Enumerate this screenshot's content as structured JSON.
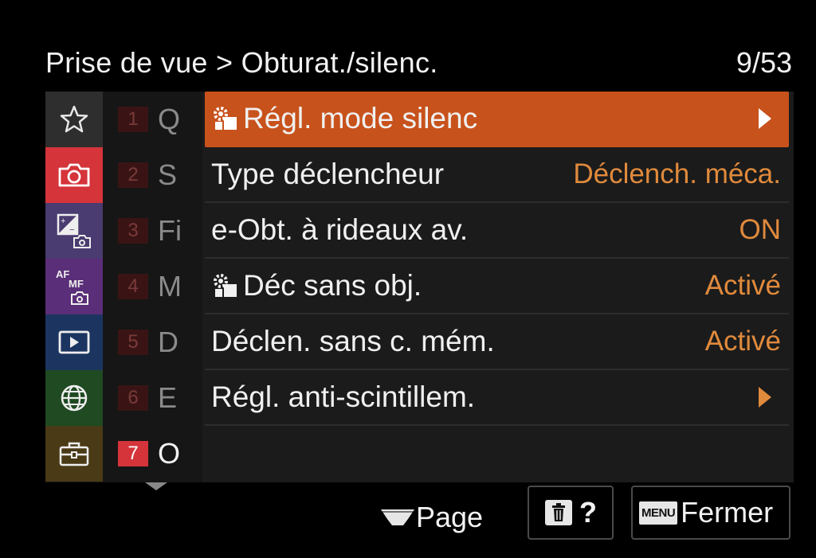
{
  "header": {
    "breadcrumb": "Prise de vue > Obturat./silenc.",
    "page_count": "9/53"
  },
  "categories": [
    {
      "icon": "star-icon",
      "bg": "#2e2e2e",
      "active": false
    },
    {
      "icon": "camera-icon",
      "bg": "#d4343a",
      "active": true
    },
    {
      "icon": "exposure-camera-icon",
      "bg": "#4a3b70",
      "active": false
    },
    {
      "icon": "af-mf-camera-icon",
      "bg": "#5a2e78",
      "active": false
    },
    {
      "icon": "playback-icon",
      "bg": "#1c3560",
      "active": false
    },
    {
      "icon": "network-globe-icon",
      "bg": "#1f4a22",
      "active": false
    },
    {
      "icon": "toolbox-icon",
      "bg": "#4a3a16",
      "active": false
    }
  ],
  "subpages": [
    {
      "num": "1",
      "letter": "Q"
    },
    {
      "num": "2",
      "letter": "S"
    },
    {
      "num": "3",
      "letter": "Fi"
    },
    {
      "num": "4",
      "letter": "M"
    },
    {
      "num": "5",
      "letter": "D"
    },
    {
      "num": "6",
      "letter": "E"
    },
    {
      "num": "7",
      "letter": "O",
      "active": true
    }
  ],
  "items": [
    {
      "label": "Régl. mode silenc",
      "value": "",
      "icon": "gear-icon",
      "arrow": true,
      "selected": true
    },
    {
      "label": "Type déclencheur",
      "value": "Déclench. méca."
    },
    {
      "label": "e-Obt. à rideaux av.",
      "value": "ON"
    },
    {
      "label": "Déc sans obj.",
      "value": "Activé",
      "icon": "gear-icon"
    },
    {
      "label": "Déclen. sans c. mém.",
      "value": "Activé"
    },
    {
      "label": "Régl. anti-scintillem.",
      "value": "",
      "arrow": true
    }
  ],
  "footer": {
    "page_label": "Page",
    "help_label": "?",
    "menu_badge": "MENU",
    "close_label": "Fermer"
  },
  "colors": {
    "accent": "#c8521c",
    "value": "#e08a3c",
    "active_number": "#d4343a"
  }
}
